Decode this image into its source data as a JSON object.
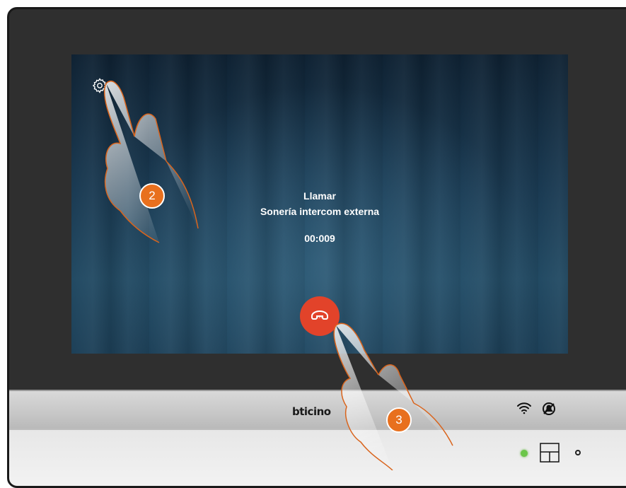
{
  "call": {
    "title": "Llamar",
    "subtitle": "Sonería intercom externa",
    "timer": "00:009"
  },
  "icons": {
    "settings": "gear-icon",
    "hangup": "phone-hangup-icon",
    "wifi": "wifi-icon",
    "mute": "mute-bell-icon",
    "home": "home-touch-icon"
  },
  "bezel": {
    "brand": "bticino"
  },
  "steps": {
    "step_2": "2",
    "step_3": "3"
  },
  "colors": {
    "hangup": "#e2432a",
    "step_badge": "#e8701e",
    "led": "#6cc64a"
  }
}
